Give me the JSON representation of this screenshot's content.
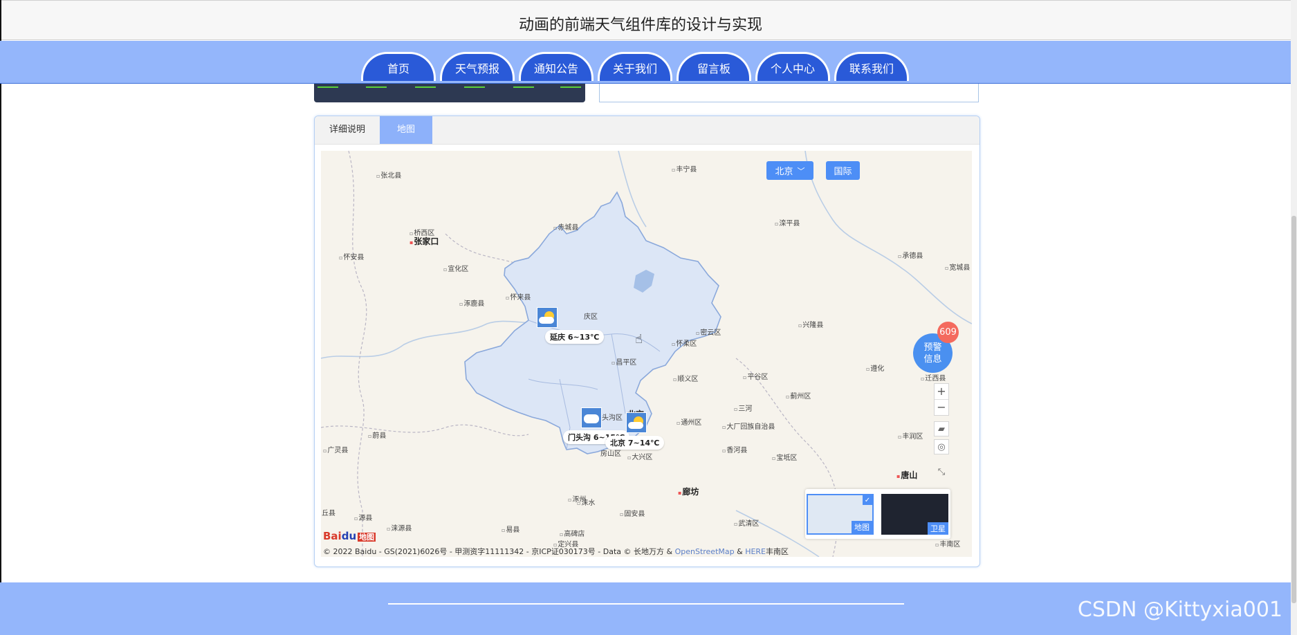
{
  "site": {
    "title": "动画的前端天气组件库的设计与实现"
  },
  "nav": {
    "items": [
      "首页",
      "天气预报",
      "通知公告",
      "关于我们",
      "留言板",
      "个人中心",
      "联系我们"
    ]
  },
  "panel": {
    "tabs": [
      {
        "label": "详细说明",
        "active": false
      },
      {
        "label": "地图",
        "active": true
      }
    ]
  },
  "map": {
    "region_button": "北京",
    "intl_button": "国际",
    "alert": {
      "label_line1": "预警",
      "label_line2": "信息",
      "count": "609"
    },
    "weather_markers": [
      {
        "label": "延庆 6~13℃",
        "icon": "partly-cloudy-icon"
      },
      {
        "label": "门头沟 6~15℃",
        "icon": "cloudy-icon"
      },
      {
        "label": "北京 7~14℃",
        "icon": "partly-cloudy-icon"
      }
    ],
    "places": [
      "张北县",
      "丰宁县",
      "赤城县",
      "滦平县",
      "桥西区",
      "张家口",
      "承德县",
      "怀安县",
      "宣化区",
      "宽城县",
      "怀来县",
      "涿鹿县",
      "庆区",
      "兴隆县",
      "密云区",
      "怀柔区",
      "昌平区",
      "遵化",
      "顺义区",
      "平谷区",
      "迁西县",
      "头沟区",
      "北京",
      "三河",
      "蓟州区",
      "通州区",
      "大厂回族自治县",
      "蔚县",
      "丰润区",
      "广灵县",
      "香河县",
      "宝坻区",
      "房山区",
      "大兴区",
      "唐山",
      "廊坊",
      "涞水",
      "源县",
      "涿州",
      "固安县",
      "武清区",
      "涞源县",
      "易县",
      "高碑店",
      "定兴县",
      "丘县",
      "丰南区"
    ],
    "layers": {
      "map_label": "地图",
      "satellite_label": "卫星"
    },
    "logo": {
      "bai": "Bai",
      "du": "du",
      "suffix": "地图"
    },
    "copyright_prefix": "© 2022 Baidu - GS(2021)6026号 - 甲测资字11111342 - 京ICP证030173号 - Data © 长地万方 & ",
    "copyright_osm": "OpenStreetMap",
    "copyright_and": " & ",
    "copyright_here": "HERE",
    "copyright_suffix": "丰南区"
  },
  "footer": {
    "watermark": "CSDN @Kittyxia001"
  },
  "colors": {
    "nav_bg": "#94b6fb",
    "tab_bg": "#2a5ad8",
    "beijing_fill": "#dde7f6",
    "accent": "#4d8ef6"
  }
}
